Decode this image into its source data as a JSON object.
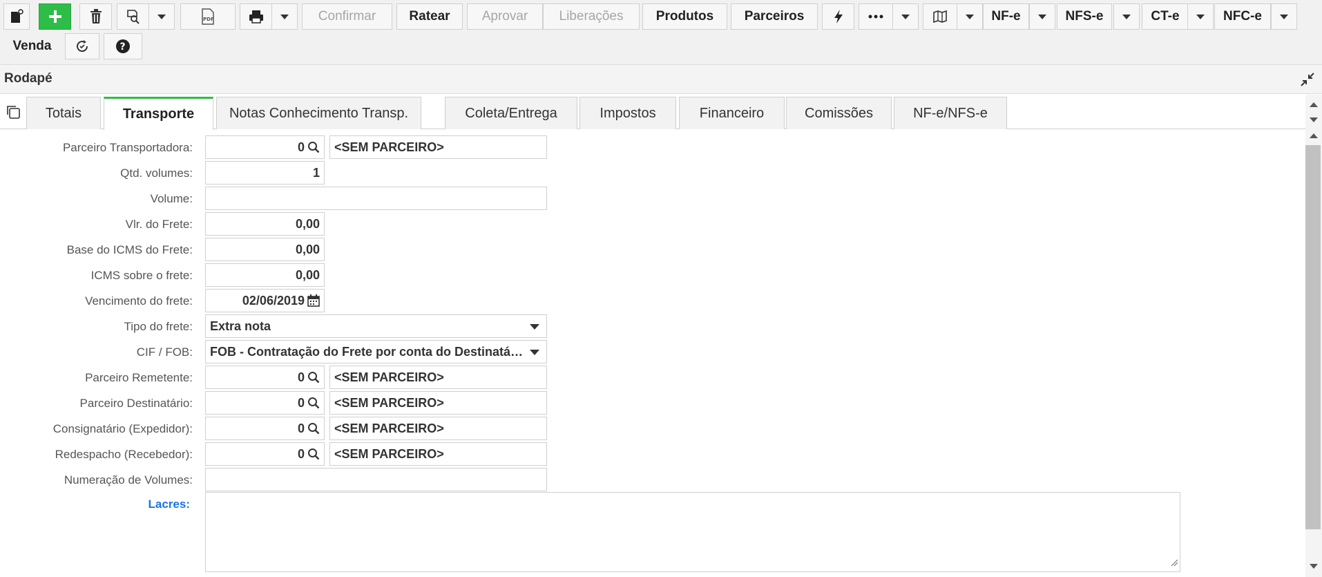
{
  "toolbar": {
    "buttons": {
      "confirmar": "Confirmar",
      "ratear": "Ratear",
      "aprovar": "Aprovar",
      "liberacoes": "Liberações",
      "produtos": "Produtos",
      "parceiros": "Parceiros",
      "nfe": "NF-e",
      "nfse": "NFS-e",
      "cte": "CT-e",
      "nfce": "NFC-e",
      "venda": "Venda"
    },
    "icons": [
      "new-document-icon",
      "add-icon",
      "trash-icon",
      "search-document-icon",
      "pdf-icon",
      "print-icon",
      "lightning-icon",
      "more-icon",
      "map-icon",
      "refresh-icon",
      "help-icon"
    ]
  },
  "section": {
    "title": "Rodapé"
  },
  "tabs": [
    {
      "label": "Totais"
    },
    {
      "label": "Transporte",
      "active": true
    },
    {
      "label": "Notas Conhecimento Transp."
    },
    {
      "label": "Coleta/Entrega"
    },
    {
      "label": "Impostos"
    },
    {
      "label": "Financeiro"
    },
    {
      "label": "Comissões"
    },
    {
      "label": "NF-e/NFS-e"
    }
  ],
  "form": {
    "parceiro_transportadora": {
      "label": "Parceiro Transportadora:",
      "code": "0",
      "name": "<SEM PARCEIRO>"
    },
    "qtd_volumes": {
      "label": "Qtd. volumes:",
      "value": "1"
    },
    "volume": {
      "label": "Volume:",
      "value": ""
    },
    "vlr_frete": {
      "label": "Vlr. do Frete:",
      "value": "0,00"
    },
    "base_icms_frete": {
      "label": "Base do ICMS do Frete:",
      "value": "0,00"
    },
    "icms_frete": {
      "label": "ICMS sobre o frete:",
      "value": "0,00"
    },
    "vencimento_frete": {
      "label": "Vencimento do frete:",
      "value": "02/06/2019"
    },
    "tipo_frete": {
      "label": "Tipo do frete:",
      "value": "Extra nota"
    },
    "cif_fob": {
      "label": "CIF / FOB:",
      "value": "FOB - Contratação do Frete por conta do Destinatário"
    },
    "parceiro_remetente": {
      "label": "Parceiro Remetente:",
      "code": "0",
      "name": "<SEM PARCEIRO>"
    },
    "parceiro_destinatario": {
      "label": "Parceiro Destinatário:",
      "code": "0",
      "name": "<SEM PARCEIRO>"
    },
    "consignatario": {
      "label": "Consignatário (Expedidor):",
      "code": "0",
      "name": "<SEM PARCEIRO>"
    },
    "redespacho": {
      "label": "Redespacho (Recebedor):",
      "code": "0",
      "name": "<SEM PARCEIRO>"
    },
    "numeracao_volumes": {
      "label": "Numeração de Volumes:",
      "value": ""
    },
    "lacres": {
      "label": "Lacres:",
      "value": ""
    }
  },
  "colors": {
    "accent": "#2ebd48",
    "link": "#1a73e8",
    "disabled_text": "#a6a6a6"
  }
}
